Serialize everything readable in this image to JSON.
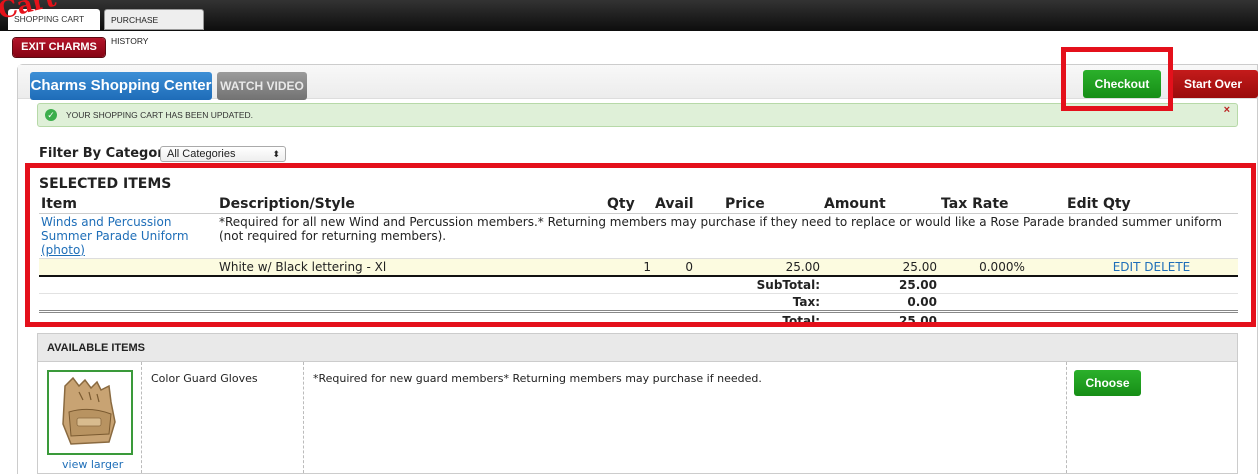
{
  "tabs": [
    {
      "label": "SHOPPING CART",
      "active": true
    },
    {
      "label": "PURCHASE HISTORY",
      "active": false
    }
  ],
  "annotation": {
    "text": "Cart",
    "color": "#e5121a"
  },
  "exit_button": "EXIT CHARMS",
  "header": {
    "center_button": "Charms Shopping Center",
    "watch_video_button": "WATCH VIDEO",
    "checkout_button": "Checkout",
    "start_over_button": "Start Over"
  },
  "alert": {
    "message": "YOUR SHOPPING CART HAS BEEN UPDATED.",
    "close": "×",
    "icon": "check-icon"
  },
  "filter": {
    "label": "Filter By Category",
    "selected": "All Categories"
  },
  "selected_items": {
    "title": "SELECTED ITEMS",
    "columns": [
      "Item",
      "Description/Style",
      "Qty",
      "Avail",
      "Price",
      "Amount",
      "Tax Rate",
      "Edit Qty"
    ],
    "item": {
      "name": "Winds and Percussion Summer Parade Uniform",
      "photo_link": "(photo)",
      "description": "*Required for all new Wind and Percussion members.* Returning members may purchase if they need to replace or would like a Rose Parade branded summer uniform (not required for returning members)."
    },
    "variant": {
      "style": "White w/ Black lettering - Xl",
      "qty": "1",
      "avail": "0",
      "price": "25.00",
      "amount": "25.00",
      "tax_rate": "0.000%",
      "edit": "EDIT",
      "delete": "DELETE"
    },
    "subtotal": {
      "label": "SubTotal:",
      "value": "25.00"
    },
    "tax": {
      "label": "Tax:",
      "value": "0.00"
    },
    "total": {
      "label": "Total:",
      "value": "25.00"
    }
  },
  "available_items": {
    "title": "AVAILABLE ITEMS",
    "items": [
      {
        "name": "Color Guard Gloves",
        "description": "*Required for new guard members* Returning members may purchase if needed.",
        "view_larger": "view larger",
        "choose": "Choose"
      }
    ]
  },
  "colors": {
    "highlight": "#e4101b",
    "checkout_green": "#2bb02b",
    "start_over_red": "#c41b1b",
    "primary_blue": "#1e6cb8",
    "alert_bg": "#dff0d8"
  }
}
